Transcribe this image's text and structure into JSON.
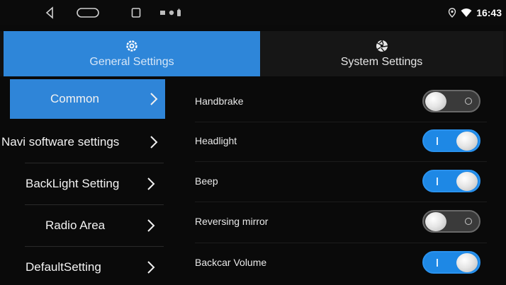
{
  "status_bar": {
    "time": "16:43",
    "icons": [
      "back-icon",
      "home-icon",
      "recent-apps-icon",
      "notification-icons",
      "location-icon",
      "wifi-icon"
    ]
  },
  "tabs": [
    {
      "label": "General Settings",
      "icon": "gear-icon",
      "active": true
    },
    {
      "label": "System Settings",
      "icon": "aperture-icon",
      "active": false
    }
  ],
  "side_menu": [
    {
      "label": "Common",
      "active": true
    },
    {
      "label": "Navi software settings",
      "active": false
    },
    {
      "label": "BackLight Setting",
      "active": false
    },
    {
      "label": "Radio Area",
      "active": false
    },
    {
      "label": "DefaultSetting",
      "active": false
    }
  ],
  "settings": [
    {
      "label": "Handbrake",
      "state": "off"
    },
    {
      "label": "Headlight",
      "state": "on"
    },
    {
      "label": "Beep",
      "state": "on"
    },
    {
      "label": "Reversing mirror",
      "state": "off"
    },
    {
      "label": "Backcar Volume",
      "state": "on"
    }
  ],
  "colors": {
    "accent": "#2e86d9",
    "toggle_on": "#1e88e5",
    "toggle_off": "#3a3a3a",
    "background": "#0a0a0a"
  }
}
